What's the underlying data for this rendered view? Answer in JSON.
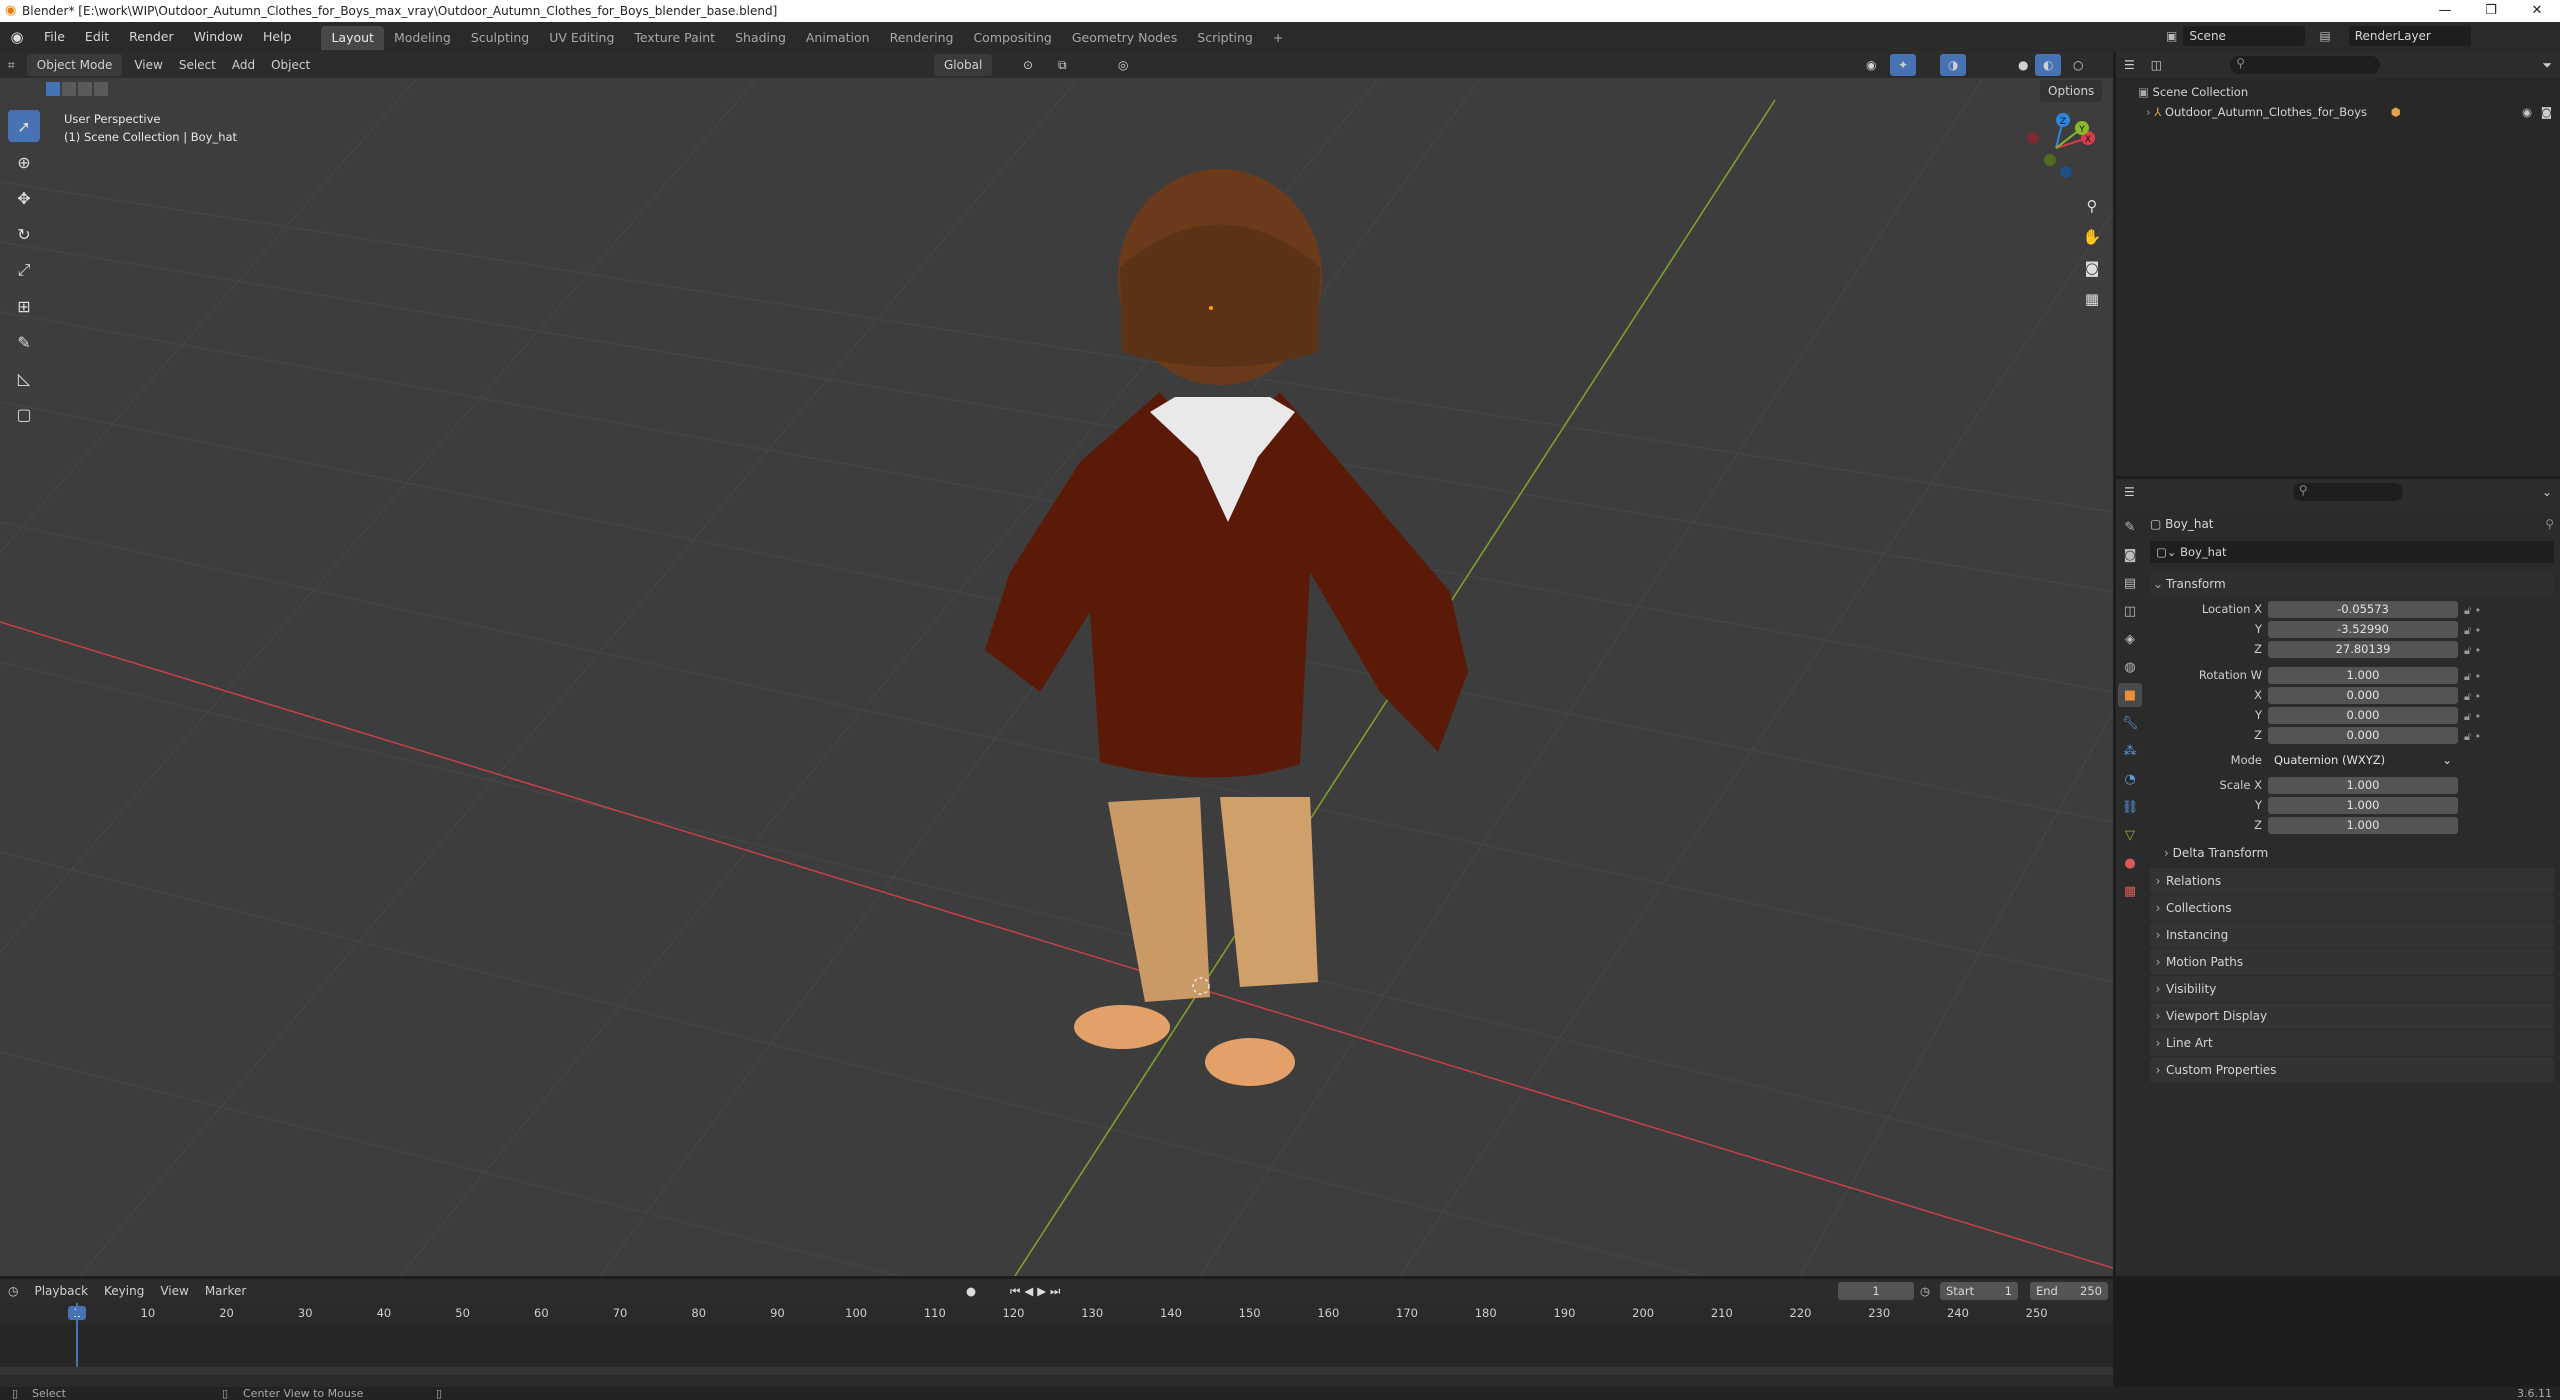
{
  "window": {
    "title": "Blender* [E:\\work\\WIP\\Outdoor_Autumn_Clothes_for_Boys_max_vray\\Outdoor_Autumn_Clothes_for_Boys_blender_base.blend]",
    "minimize": "—",
    "restore": "❐",
    "close": "✕"
  },
  "menu": {
    "items": [
      "File",
      "Edit",
      "Render",
      "Window",
      "Help"
    ],
    "workspaces": [
      "Layout",
      "Modeling",
      "Sculpting",
      "UV Editing",
      "Texture Paint",
      "Shading",
      "Animation",
      "Rendering",
      "Compositing",
      "Geometry Nodes",
      "Scripting"
    ],
    "active_workspace": "Layout",
    "add_tab": "+",
    "scene": "Scene",
    "render_layer": "RenderLayer"
  },
  "viewport": {
    "mode": "Object Mode",
    "menus": [
      "View",
      "Select",
      "Add",
      "Object"
    ],
    "transform_orientation": "Global",
    "options": "Options",
    "overlay_line1": "User Perspective",
    "overlay_line2": "(1) Scene Collection | Boy_hat",
    "gizmo_axes": [
      "Z",
      "Y",
      "X"
    ]
  },
  "outliner": {
    "search_placeholder": "",
    "root": "Scene Collection",
    "items": [
      {
        "label": "Outdoor_Autumn_Clothes_for_Boys"
      }
    ]
  },
  "properties": {
    "object_name": "Boy_hat",
    "data_name": "Boy_hat",
    "transform_header": "Transform",
    "location": {
      "label": "Location X",
      "x": "-0.05573",
      "y": "-3.52990",
      "z": "27.80139"
    },
    "rotation": {
      "label": "Rotation W",
      "w": "1.000",
      "x": "0.000",
      "y": "0.000",
      "z": "0.000"
    },
    "mode_label": "Mode",
    "mode_value": "Quaternion (WXYZ)",
    "scale": {
      "label": "Scale X",
      "x": "1.000",
      "y": "1.000",
      "z": "1.000"
    },
    "axis_labels": {
      "x": "X",
      "y": "Y",
      "z": "Z"
    },
    "delta": "Delta Transform",
    "panels": [
      "Relations",
      "Collections",
      "Instancing",
      "Motion Paths",
      "Visibility",
      "Viewport Display",
      "Line Art",
      "Custom Properties"
    ]
  },
  "timeline": {
    "menus": [
      "Playback",
      "Keying",
      "View",
      "Marker"
    ],
    "current_frame": "1",
    "start_label": "Start",
    "start": "1",
    "end_label": "End",
    "end": "250",
    "ticks": [
      "1",
      "10",
      "20",
      "30",
      "40",
      "50",
      "60",
      "70",
      "80",
      "90",
      "100",
      "110",
      "120",
      "130",
      "140",
      "150",
      "160",
      "170",
      "180",
      "190",
      "200",
      "210",
      "220",
      "230",
      "240",
      "250"
    ]
  },
  "status": {
    "select": "Select",
    "center_view": "Center View to Mouse",
    "version": "3.6.11"
  },
  "colors": {
    "accent": "#4772b3",
    "x_axis": "#d83a4a",
    "y_axis": "#8ab92a",
    "z_axis": "#2e86de",
    "viewport_bg": "#3d3d3d"
  }
}
